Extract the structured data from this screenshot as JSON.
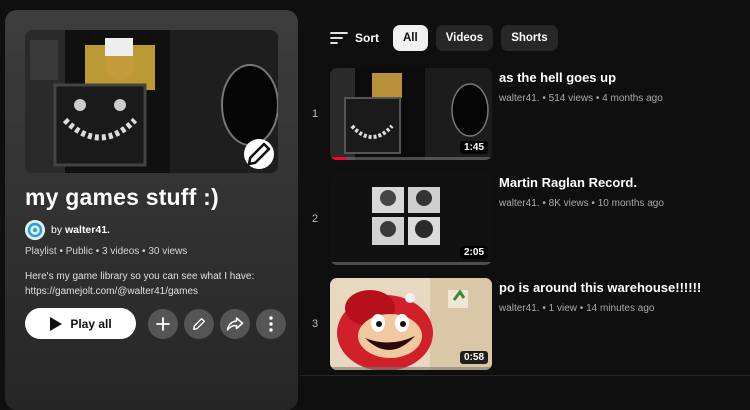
{
  "playlist": {
    "title": "my games stuff :)",
    "owner_prefix": "by",
    "owner": "walter41.",
    "meta": "Playlist • Public • 3 videos • 30 views",
    "description_line1": "Here's my game library so you can see what I have:",
    "description_line2": "https://gamejolt.com/@walter41/games",
    "play_all_label": "Play all"
  },
  "filters": {
    "sort_label": "Sort",
    "chips": [
      {
        "label": "All",
        "active": true
      },
      {
        "label": "Videos",
        "active": false
      },
      {
        "label": "Shorts",
        "active": false
      }
    ]
  },
  "videos": [
    {
      "index": "1",
      "title": "as the hell goes up",
      "channel": "walter41.",
      "views": "514 views",
      "age": "4 months ago",
      "duration": "1:45",
      "watched_fraction": 0.1
    },
    {
      "index": "2",
      "title": "Martin Raglan Record.",
      "channel": "walter41.",
      "views": "8K views",
      "age": "10 months ago",
      "duration": "2:05",
      "watched_fraction": 0.0
    },
    {
      "index": "3",
      "title": "po is around this warehouse!!!!!!",
      "channel": "walter41.",
      "views": "1 view",
      "age": "14 minutes ago",
      "duration": "0:58",
      "watched_fraction": 0.0
    }
  ],
  "icons": {
    "sort": "sort-icon",
    "edit": "pencil-icon",
    "add": "plus-icon",
    "share": "share-icon",
    "more": "more-vert-icon",
    "play": "play-icon"
  },
  "colors": {
    "accent": "#ff0033",
    "background": "#0f0f0f",
    "chip_active": "#f1f1f1"
  }
}
